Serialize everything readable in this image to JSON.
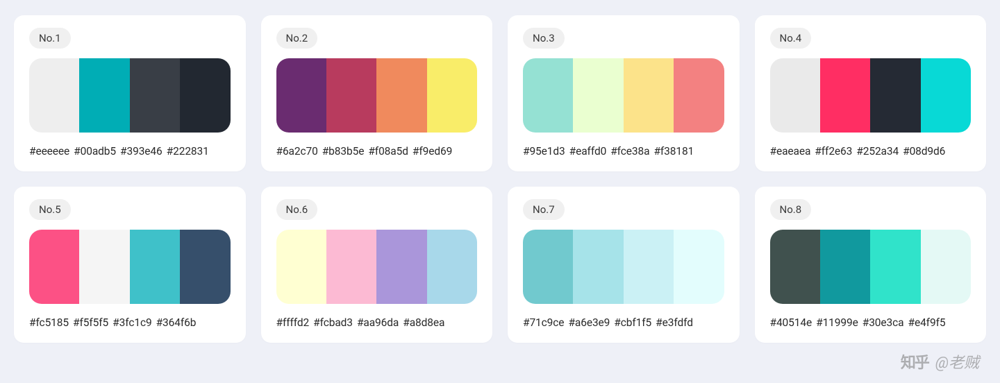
{
  "palettes": [
    {
      "badge": "No.1",
      "colors": [
        "#eeeeee",
        "#00adb5",
        "#393e46",
        "#222831"
      ]
    },
    {
      "badge": "No.2",
      "colors": [
        "#6a2c70",
        "#b83b5e",
        "#f08a5d",
        "#f9ed69"
      ]
    },
    {
      "badge": "No.3",
      "colors": [
        "#95e1d3",
        "#eaffd0",
        "#fce38a",
        "#f38181"
      ]
    },
    {
      "badge": "No.4",
      "colors": [
        "#eaeaea",
        "#ff2e63",
        "#252a34",
        "#08d9d6"
      ]
    },
    {
      "badge": "No.5",
      "colors": [
        "#fc5185",
        "#f5f5f5",
        "#3fc1c9",
        "#364f6b"
      ]
    },
    {
      "badge": "No.6",
      "colors": [
        "#ffffd2",
        "#fcbad3",
        "#aa96da",
        "#a8d8ea"
      ]
    },
    {
      "badge": "No.7",
      "colors": [
        "#71c9ce",
        "#a6e3e9",
        "#cbf1f5",
        "#e3fdfd"
      ]
    },
    {
      "badge": "No.8",
      "colors": [
        "#40514e",
        "#11999e",
        "#30e3ca",
        "#e4f9f5"
      ]
    }
  ],
  "watermark": {
    "brand": "知乎",
    "author": "@老贼"
  }
}
